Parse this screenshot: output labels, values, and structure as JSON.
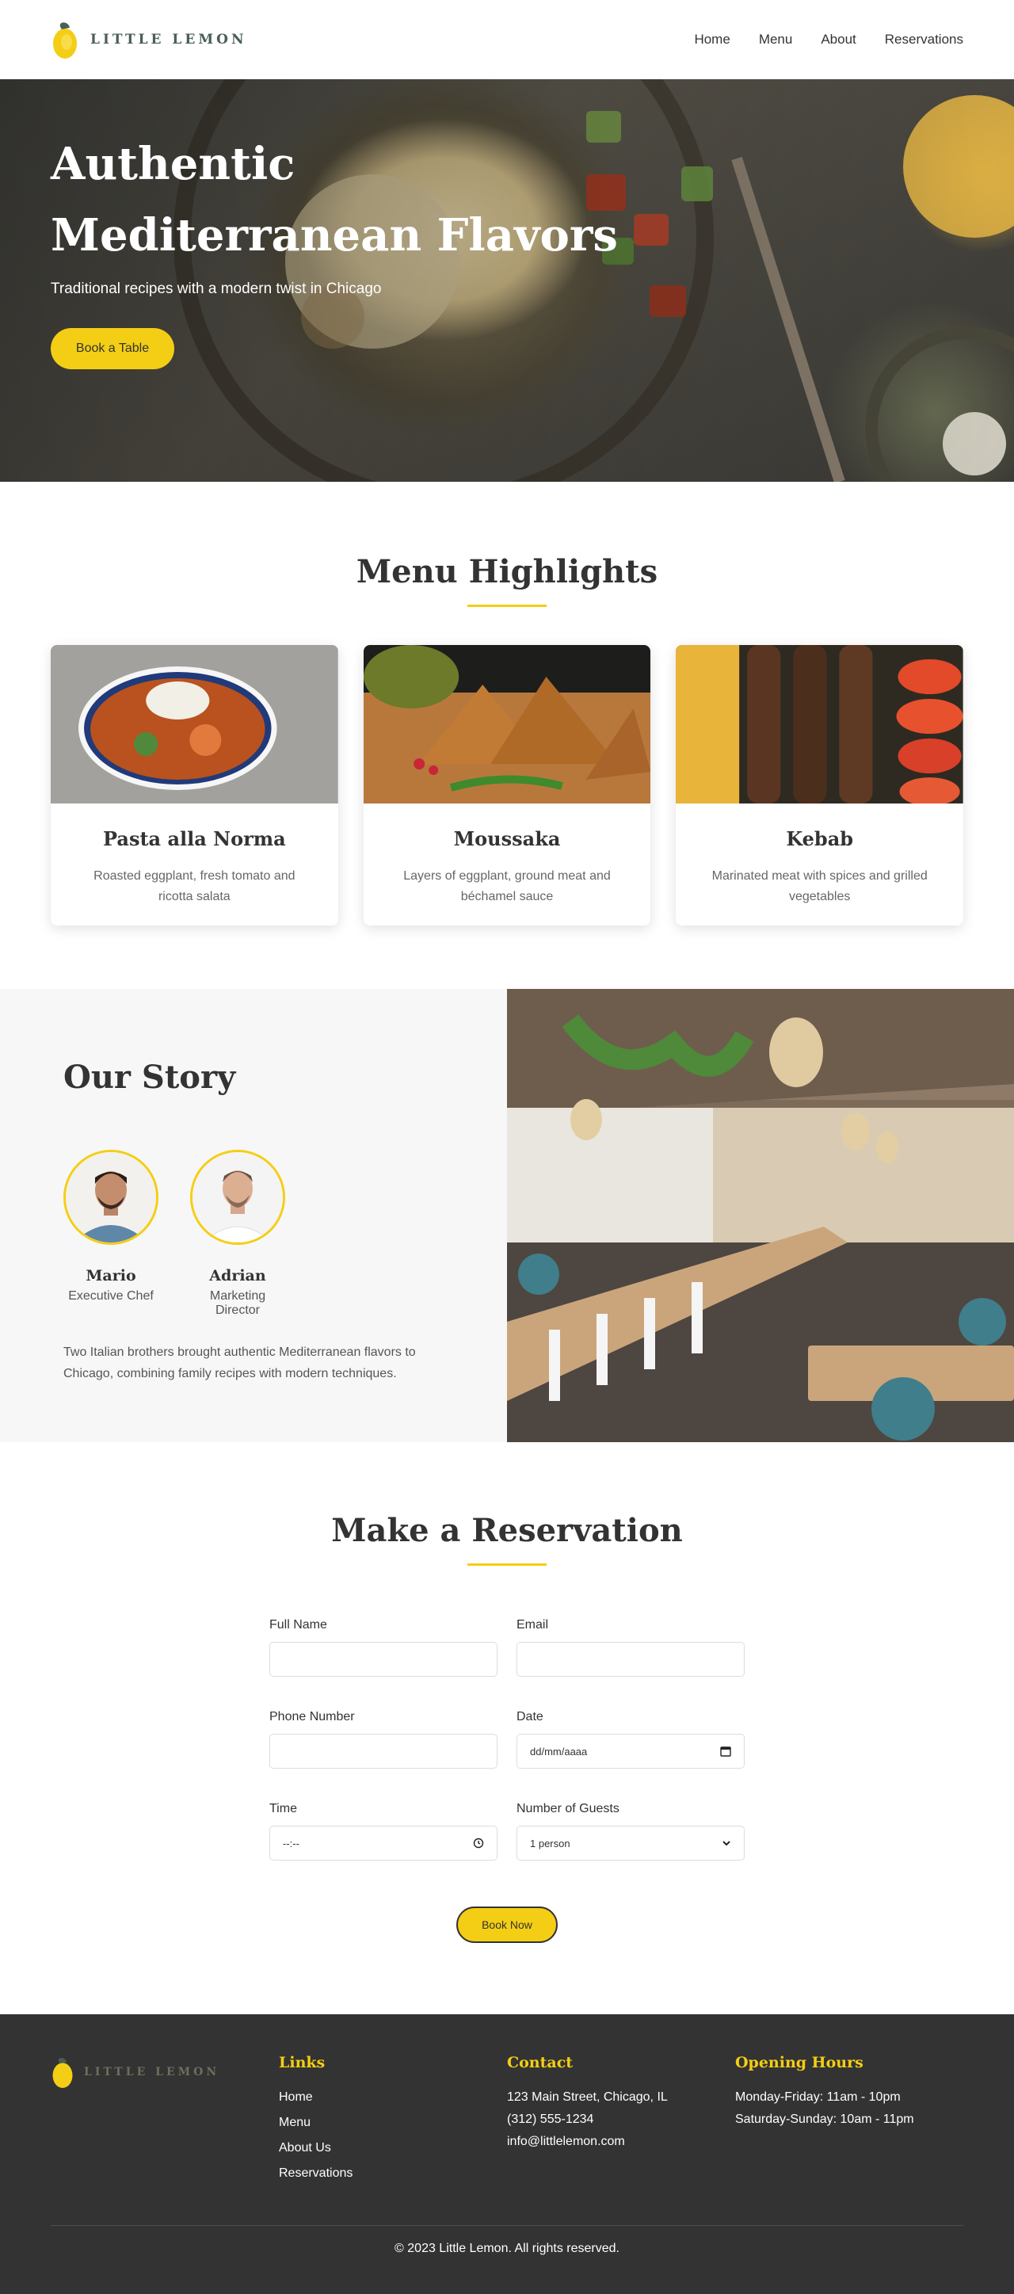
{
  "header": {
    "brand": "LITTLE LEMON",
    "nav": [
      "Home",
      "Menu",
      "About",
      "Reservations"
    ]
  },
  "hero": {
    "title_line1": "Authentic",
    "title_line2": "Mediterranean Flavors",
    "subtitle": "Traditional recipes with a modern twist in Chicago",
    "cta": "Book a Table"
  },
  "menu": {
    "title": "Menu Highlights",
    "items": [
      {
        "name": "Pasta alla Norma",
        "desc": "Roasted eggplant, fresh tomato and ricotta salata"
      },
      {
        "name": "Moussaka",
        "desc": "Layers of eggplant, ground meat and béchamel sauce"
      },
      {
        "name": "Kebab",
        "desc": "Marinated meat with spices and grilled vegetables"
      }
    ]
  },
  "story": {
    "title": "Our Story",
    "people": [
      {
        "name": "Mario",
        "role": "Executive Chef"
      },
      {
        "name": "Adrian",
        "role": "Marketing Director"
      }
    ],
    "description": "Two Italian brothers brought authentic Mediterranean flavors to Chicago, combining family recipes with modern techniques."
  },
  "reservation": {
    "title": "Make a Reservation",
    "fields": {
      "full_name": {
        "label": "Full Name",
        "value": ""
      },
      "email": {
        "label": "Email",
        "value": ""
      },
      "phone": {
        "label": "Phone Number",
        "value": ""
      },
      "date": {
        "label": "Date",
        "value": "dd/mm/aaaa"
      },
      "time": {
        "label": "Time",
        "value": "--:--"
      },
      "guests": {
        "label": "Number of Guests",
        "value": "1 person"
      }
    },
    "submit": "Book Now"
  },
  "footer": {
    "brand": "LITTLE LEMON",
    "links_title": "Links",
    "links": [
      "Home",
      "Menu",
      "About Us",
      "Reservations"
    ],
    "contact_title": "Contact",
    "contact": [
      "123 Main Street, Chicago, IL",
      "(312) 555-1234",
      "info@littlelemon.com"
    ],
    "hours_title": "Opening Hours",
    "hours": [
      "Monday-Friday: 11am - 10pm",
      "Saturday-Sunday: 10am - 11pm"
    ],
    "copyright": "© 2023 Little Lemon. All rights reserved."
  },
  "colors": {
    "accent": "#f4ce14",
    "brand_green": "#495e57",
    "footer_bg": "#333333"
  }
}
